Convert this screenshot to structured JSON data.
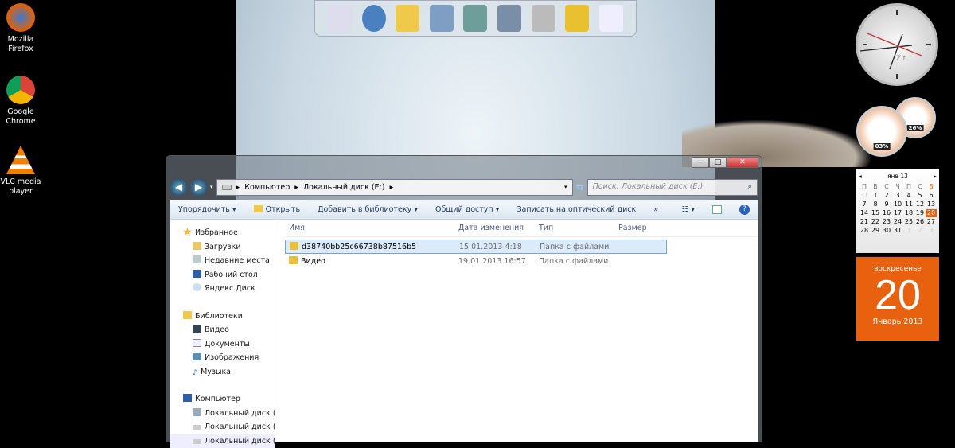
{
  "desktop_icons": [
    {
      "label": "Mozilla Firefox",
      "color": "#e66000"
    },
    {
      "label": "Google Chrome",
      "color": "#4285f4"
    },
    {
      "label": "VLC media player",
      "color": "#f08000"
    }
  ],
  "explorer": {
    "title_buttons": [
      "–",
      "□",
      "✕"
    ],
    "breadcrumb": [
      "Компьютер",
      "Локальный диск (E:)"
    ],
    "search_placeholder": "Поиск: Локальный диск (E:)",
    "toolbar": {
      "organize": "Упорядочить ▾",
      "open": "Открыть",
      "add_library": "Добавить в библиотеку ▾",
      "share": "Общий доступ ▾",
      "burn": "Записать на оптический диск",
      "more": "»"
    },
    "nav": {
      "favorites": {
        "label": "Избранное",
        "items": [
          "Загрузки",
          "Недавние места",
          "Рабочий стол",
          "Яндекс.Диск"
        ]
      },
      "libraries": {
        "label": "Библиотеки",
        "items": [
          "Видео",
          "Документы",
          "Изображения",
          "Музыка"
        ]
      },
      "computer": {
        "label": "Компьютер",
        "items": [
          "Локальный диск (C:)",
          "Локальный диск (D:)",
          "Локальный диск (E:)"
        ]
      }
    },
    "columns": [
      "Имя",
      "Дата изменения",
      "Тип",
      "Размер"
    ],
    "files": [
      {
        "name": "d38740bb25c66738b87516b5",
        "date": "15.01.2013 4:18",
        "type": "Папка с файлами",
        "size": ""
      },
      {
        "name": "Видео",
        "date": "19.01.2013 16:57",
        "type": "Папка с файлами",
        "size": ""
      }
    ]
  },
  "gadgets": {
    "clock_brand": "Zit",
    "cpu": "03%",
    "ram": "26%",
    "calendar": {
      "month": "янв 13",
      "weekdays": [
        "П",
        "В",
        "С",
        "Ч",
        "П",
        "С",
        "В"
      ],
      "days": [
        "31",
        "1",
        "2",
        "3",
        "4",
        "5",
        "6",
        "7",
        "8",
        "9",
        "10",
        "11",
        "12",
        "13",
        "14",
        "15",
        "16",
        "17",
        "18",
        "19",
        "20",
        "21",
        "22",
        "23",
        "24",
        "25",
        "26",
        "27",
        "28",
        "29",
        "30",
        "31",
        "1",
        "2",
        "3"
      ],
      "weekday": "воскресенье",
      "day": "20",
      "month_year": "Январь 2013",
      "accent": "#e8610f"
    }
  }
}
